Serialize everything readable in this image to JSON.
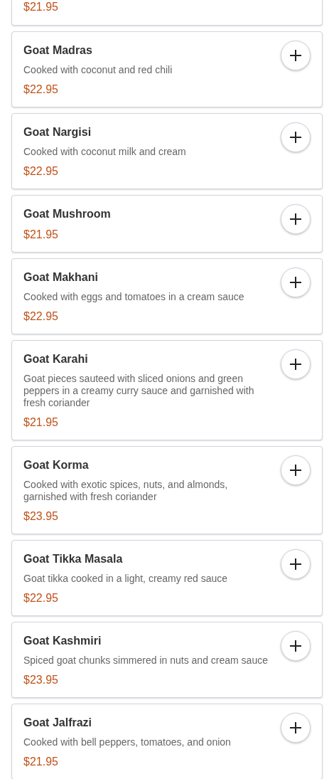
{
  "items": [
    {
      "price": "$21.95"
    },
    {
      "name": "Goat Madras",
      "description": "Cooked with coconut and red chili",
      "price": "$22.95"
    },
    {
      "name": "Goat Nargisi",
      "description": "Cooked with coconut milk and cream",
      "price": "$22.95"
    },
    {
      "name": "Goat Mushroom",
      "price": "$21.95"
    },
    {
      "name": "Goat Makhani",
      "description": "Cooked with eggs and tomatoes in a cream sauce",
      "price": "$22.95"
    },
    {
      "name": "Goat Karahi",
      "description": "Goat pieces sauteed with sliced onions and green peppers in a creamy curry sauce and garnished with fresh coriander",
      "price": "$21.95"
    },
    {
      "name": "Goat Korma",
      "description": "Cooked with exotic spices, nuts, and almonds, garnished with fresh coriander",
      "price": "$23.95"
    },
    {
      "name": "Goat Tikka Masala",
      "description": "Goat tikka cooked in a light, creamy red sauce",
      "price": "$22.95"
    },
    {
      "name": "Goat Kashmiri",
      "description": "Spiced goat chunks simmered in nuts and cream sauce",
      "price": "$23.95"
    },
    {
      "name": "Goat Jalfrazi",
      "description": "Cooked with bell peppers, tomatoes, and onion",
      "price": "$21.95"
    }
  ]
}
